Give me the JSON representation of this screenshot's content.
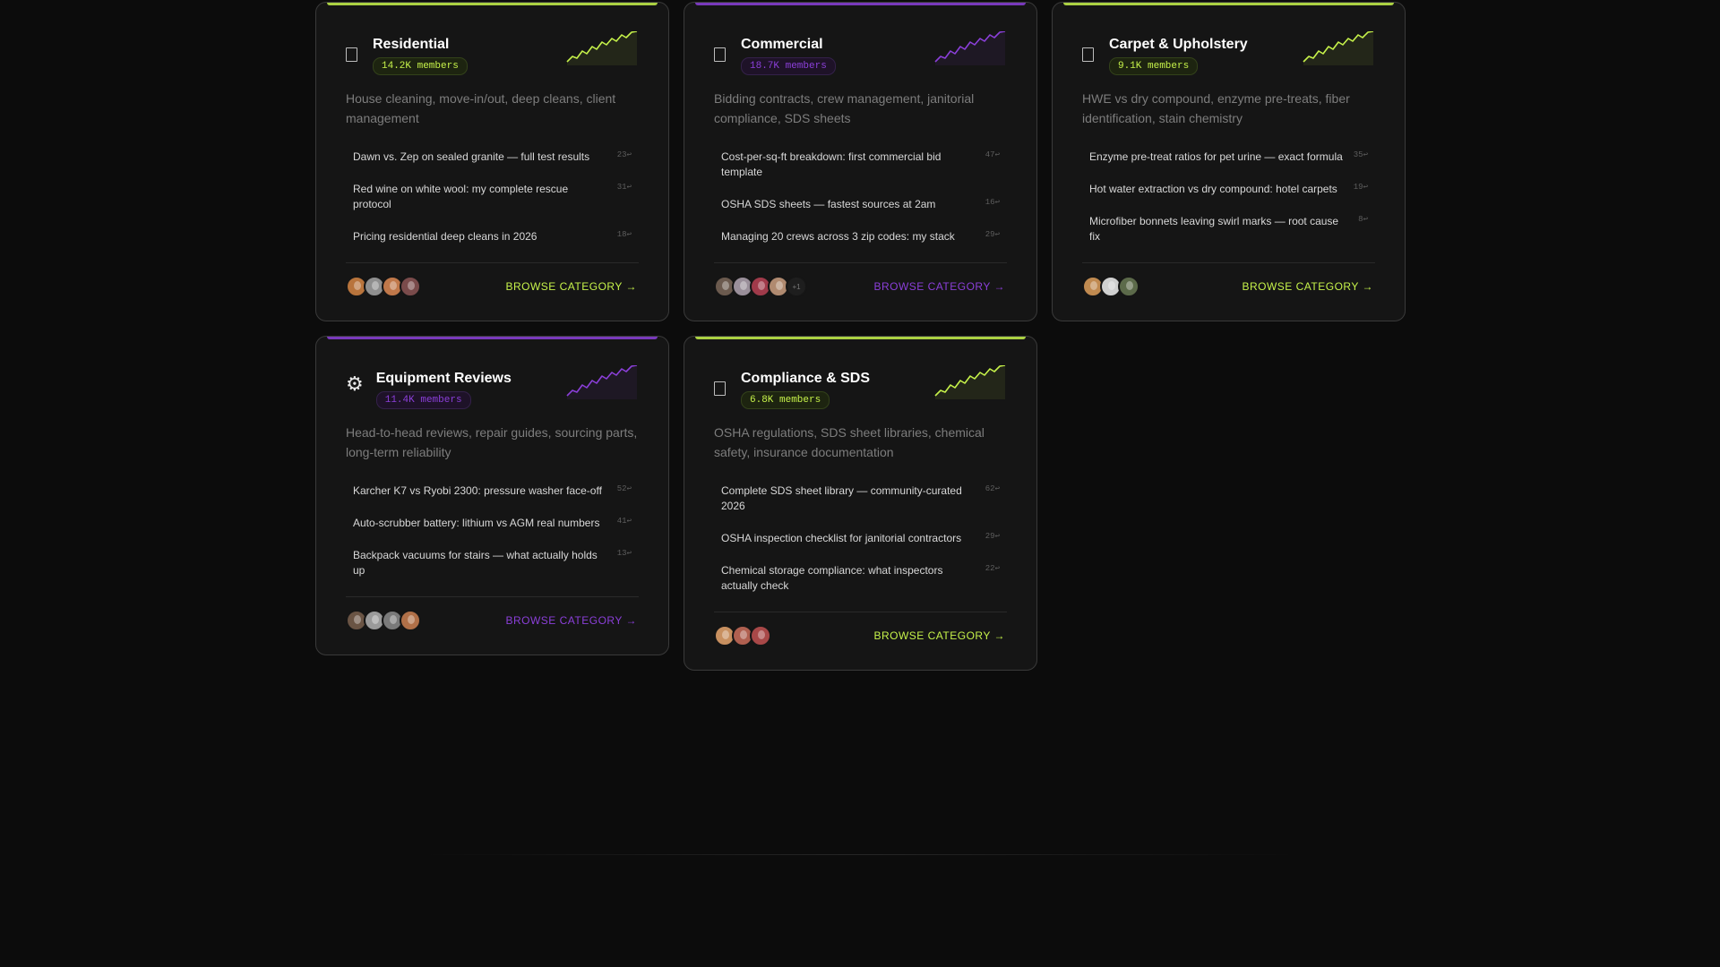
{
  "colors": {
    "lime": "#c6f24a",
    "purple": "#8b3fd9"
  },
  "cards": [
    {
      "title": "Residential",
      "members": "14.2K members",
      "icon": "document-icon",
      "accent": "lime",
      "description": "House cleaning, move-in/out, deep cleans, client management",
      "threads": [
        {
          "title": "Dawn vs. Zep on sealed granite — full test results",
          "count": "23↩"
        },
        {
          "title": "Red wine on white wool: my complete rescue protocol",
          "count": "31↩"
        },
        {
          "title": "Pricing residential deep cleans in 2026",
          "count": "18↩"
        }
      ],
      "avatars": [
        "#b8743c",
        "#8f8f8f",
        "#c0784a",
        "#7a4b4b"
      ],
      "avatars_extra": "",
      "browse_label": "BROWSE CATEGORY →"
    },
    {
      "title": "Commercial",
      "members": "18.7K members",
      "icon": "document-icon",
      "accent": "purple",
      "description": "Bidding contracts, crew management, janitorial compliance, SDS sheets",
      "threads": [
        {
          "title": "Cost-per-sq-ft breakdown: first commercial bid template",
          "count": "47↩"
        },
        {
          "title": "OSHA SDS sheets — fastest sources at 2am",
          "count": "16↩"
        },
        {
          "title": "Managing 20 crews across 3 zip codes: my stack",
          "count": "29↩"
        }
      ],
      "avatars": [
        "#6b5a4e",
        "#9a8f9a",
        "#a03a4a",
        "#b08a70"
      ],
      "avatars_extra": "+1",
      "browse_label": "BROWSE CATEGORY →"
    },
    {
      "title": "Carpet & Upholstery",
      "members": "9.1K members",
      "icon": "document-icon",
      "accent": "lime",
      "description": "HWE vs dry compound, enzyme pre-treats, fiber identification, stain chemistry",
      "threads": [
        {
          "title": "Enzyme pre-treat ratios for pet urine — exact formula",
          "count": "35↩"
        },
        {
          "title": "Hot water extraction vs dry compound: hotel carpets",
          "count": "19↩"
        },
        {
          "title": "Microfiber bonnets leaving swirl marks — root cause fix",
          "count": "8↩"
        }
      ],
      "avatars": [
        "#c08a50",
        "#d0d0d0",
        "#5c6a4a"
      ],
      "avatars_extra": "",
      "browse_label": "BROWSE CATEGORY →"
    },
    {
      "title": "Equipment Reviews",
      "members": "11.4K members",
      "icon": "gear-icon",
      "accent": "purple",
      "description": "Head-to-head reviews, repair guides, sourcing parts, long-term reliability",
      "threads": [
        {
          "title": "Karcher K7 vs Ryobi 2300: pressure washer face-off",
          "count": "52↩"
        },
        {
          "title": "Auto-scrubber battery: lithium vs AGM real numbers",
          "count": "41↩"
        },
        {
          "title": "Backpack vacuums for stairs — what actually holds up",
          "count": "13↩"
        }
      ],
      "avatars": [
        "#6a5444",
        "#9a9a9a",
        "#7a7a7a",
        "#b07048"
      ],
      "avatars_extra": "",
      "browse_label": "BROWSE CATEGORY →"
    },
    {
      "title": "Compliance & SDS",
      "members": "6.8K members",
      "icon": "document-icon",
      "accent": "lime",
      "description": "OSHA regulations, SDS sheet libraries, chemical safety, insurance documentation",
      "threads": [
        {
          "title": "Complete SDS sheet library — community-curated 2026",
          "count": "62↩"
        },
        {
          "title": "OSHA inspection checklist for janitorial contractors",
          "count": "29↩"
        },
        {
          "title": "Chemical storage compliance: what inspectors actually check",
          "count": "22↩"
        }
      ],
      "avatars": [
        "#c89060",
        "#b06050",
        "#a84848"
      ],
      "avatars_extra": "",
      "browse_label": "BROWSE CATEGORY →"
    }
  ]
}
